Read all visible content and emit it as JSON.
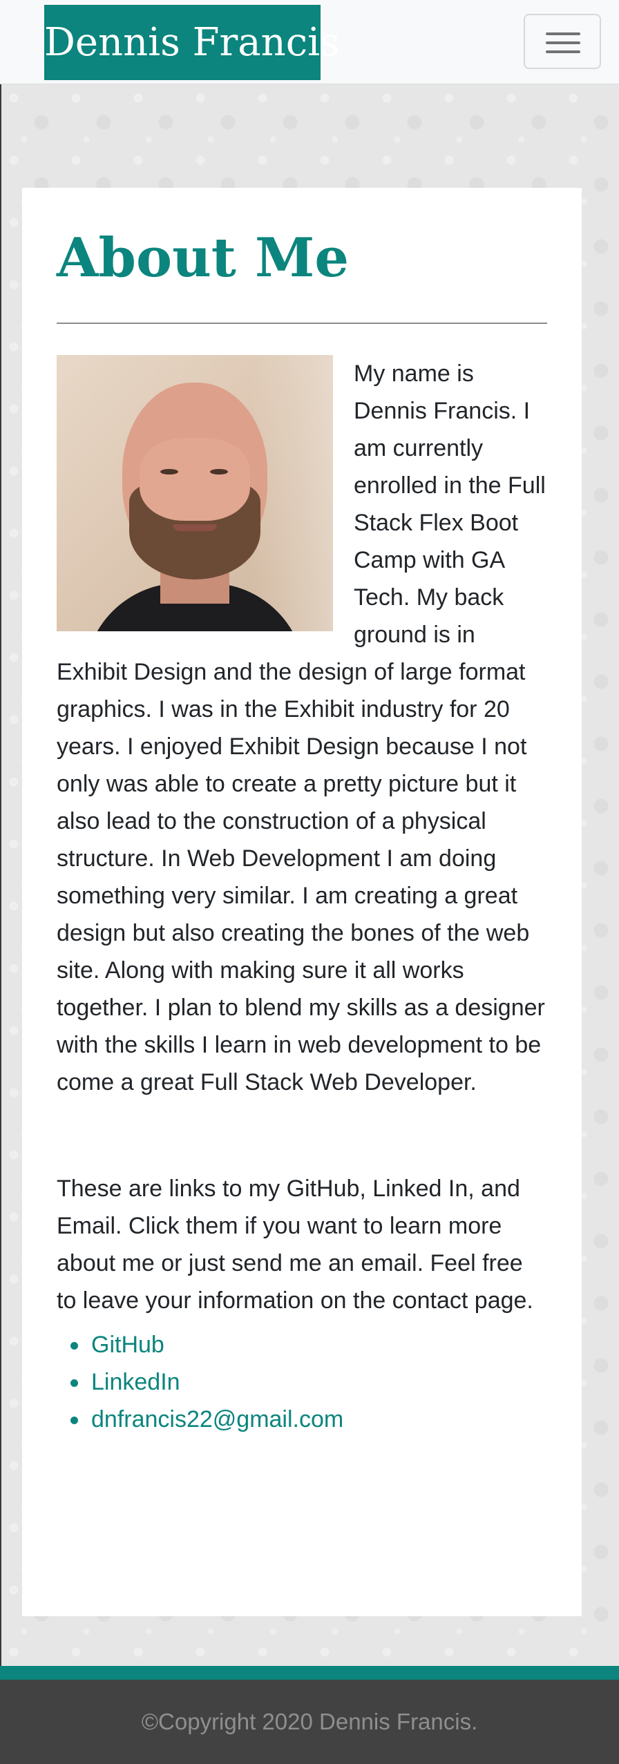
{
  "navbar": {
    "brand": "Dennis Francis",
    "toggle_icon": "hamburger-menu-icon"
  },
  "about": {
    "title": "About Me",
    "photo_alt": "Photo of Dennis Francis",
    "paragraph1": "My name is Dennis Francis. I am currently enrolled in the Full Stack Flex Boot Camp with GA Tech. My back ground is in Exhibit Design and the design of large format graphics. I was in the Exhibit industry for 20 years. I enjoyed Exhibit Design because I not only was able to create a pretty picture but it also lead to the construction of a physical structure. In Web Development I am doing something very similar. I am creating a great design but also creating the bones of the web site. Along with making sure it all works together. I plan to blend my skills as a designer with the skills I learn in web development to be come a great Full Stack Web Developer.",
    "paragraph2": "These are links to my GitHub, Linked In, and Email. Click them if you want to learn more about me or just send me an email. Feel free to leave your information on the contact page.",
    "links": [
      {
        "label": "GitHub"
      },
      {
        "label": "LinkedIn"
      },
      {
        "label": "dnfrancis22@gmail.com"
      }
    ]
  },
  "footer": {
    "copyright": "©Copyright 2020 Dennis Francis."
  },
  "colors": {
    "brand": "#0b857d",
    "footer_bg": "#424242",
    "navbar_bg": "#f8f9fa"
  }
}
